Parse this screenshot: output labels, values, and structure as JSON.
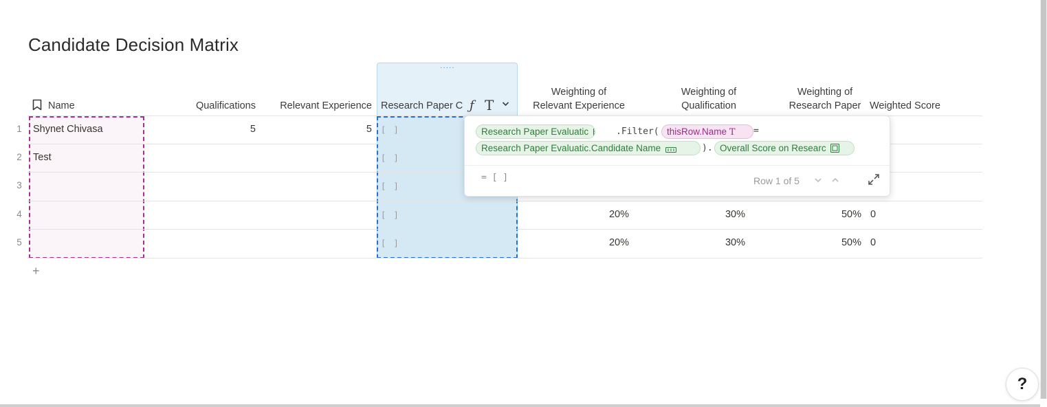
{
  "page": {
    "title": "Candidate Decision Matrix"
  },
  "table": {
    "columns": [
      {
        "key": "name",
        "label": "Name"
      },
      {
        "key": "qualifications",
        "label": "Qualifications"
      },
      {
        "key": "relevant_experience",
        "label": "Relevant Experience"
      },
      {
        "key": "research_paper",
        "label": "Research Paper C"
      },
      {
        "key": "w_experience",
        "label_line1": "Weighting of",
        "label_line2": "Relevant Experience"
      },
      {
        "key": "w_qualification",
        "label_line1": "Weighting of",
        "label_line2": "Qualification"
      },
      {
        "key": "w_research",
        "label_line1": "Weighting of",
        "label_line2": "Research Paper"
      },
      {
        "key": "weighted_score",
        "label": "Weighted Score"
      }
    ],
    "rows": [
      {
        "num": "1",
        "name": "Shynet Chivasa",
        "qualifications": "5",
        "relevant_experience": "5",
        "research_paper": "[ ]",
        "w_experience": "",
        "w_qualification": "",
        "w_research": "",
        "weighted_score": ""
      },
      {
        "num": "2",
        "name": "Test",
        "qualifications": "",
        "relevant_experience": "",
        "research_paper": "[ ]",
        "w_experience": "",
        "w_qualification": "",
        "w_research": "",
        "weighted_score": ""
      },
      {
        "num": "3",
        "name": "",
        "qualifications": "",
        "relevant_experience": "",
        "research_paper": "[ ]",
        "w_experience": "",
        "w_qualification": "",
        "w_research": "",
        "weighted_score": ""
      },
      {
        "num": "4",
        "name": "",
        "qualifications": "",
        "relevant_experience": "",
        "research_paper": "[ ]",
        "w_experience": "20%",
        "w_qualification": "30%",
        "w_research": "50%",
        "weighted_score": "0"
      },
      {
        "num": "5",
        "name": "",
        "qualifications": "",
        "relevant_experience": "",
        "research_paper": "[ ]",
        "w_experience": "20%",
        "w_qualification": "30%",
        "w_research": "50%",
        "weighted_score": "0"
      }
    ],
    "add_row_label": "+"
  },
  "formula_popup": {
    "chip_table": "Research Paper Evaluatic",
    "filter_text": ".Filter(",
    "chip_this_row": "thisRow.Name",
    "equals": "=",
    "chip_column": "Research Paper Evaluatic.Candidate Name",
    "dot": ").",
    "chip_score": "Overall Score on Researc",
    "result": "= [ ]",
    "row_counter": "Row 1 of 5"
  },
  "help": {
    "label": "?"
  },
  "colors": {
    "accent_blue": "#2a6fc9",
    "selection_pink": "#a3328c",
    "chip_green": "#2e7d3a",
    "chip_pink": "#9b2c85"
  },
  "icons": [
    "bookmark-icon",
    "formula-icon",
    "text-type-icon",
    "chevron-down-icon",
    "table-icon",
    "expand-icon"
  ]
}
